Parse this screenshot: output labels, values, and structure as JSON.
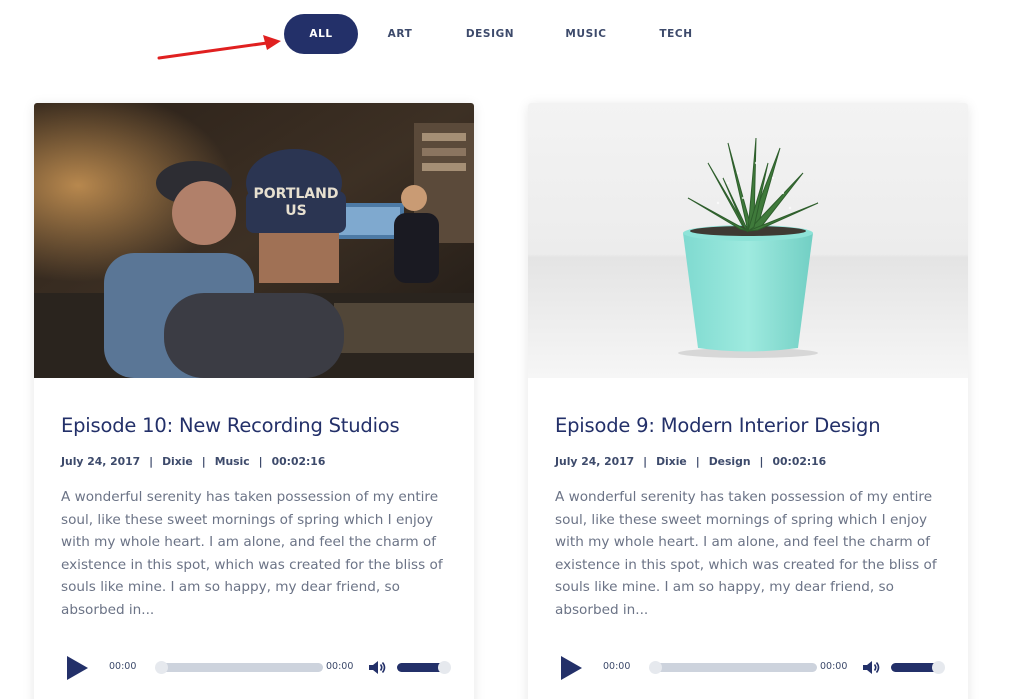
{
  "filters": [
    {
      "label": "ALL",
      "active": true
    },
    {
      "label": "ART",
      "active": false
    },
    {
      "label": "DESIGN",
      "active": false
    },
    {
      "label": "MUSIC",
      "active": false
    },
    {
      "label": "TECH",
      "active": false
    }
  ],
  "colors": {
    "accent": "#233069",
    "arrow": "#e02020",
    "text_muted": "#6b7386"
  },
  "episodes": [
    {
      "title": "Episode 10: New Recording Studios",
      "date": "July 24, 2017",
      "author": "Dixie",
      "category": "Music",
      "duration": "00:02:16",
      "excerpt": "A wonderful serenity has taken possession of my entire soul, like these sweet mornings of spring which I enjoy with my whole heart. I am alone, and feel the charm of existence in this spot, which was created for the bliss of souls like mine. I am so happy, my dear friend, so absorbed in...",
      "player": {
        "current": "00:00",
        "total": "00:00",
        "progress": 0,
        "volume": 1.0
      }
    },
    {
      "title": "Episode 9: Modern Interior Design",
      "date": "July 24, 2017",
      "author": "Dixie",
      "category": "Design",
      "duration": "00:02:16",
      "excerpt": "A wonderful serenity has taken possession of my entire soul, like these sweet mornings of spring which I enjoy with my whole heart. I am alone, and feel the charm of existence in this spot, which was created for the bliss of souls like mine. I am so happy, my dear friend, so absorbed in...",
      "player": {
        "current": "00:00",
        "total": "00:00",
        "progress": 0,
        "volume": 1.0
      }
    }
  ],
  "meta_separator": "|",
  "icons": {
    "play": "play-icon",
    "volume": "volume-icon",
    "arrow": "red-arrow-annotation"
  },
  "card_images": [
    "recording-studio-photo",
    "succulent-plant-photo"
  ]
}
